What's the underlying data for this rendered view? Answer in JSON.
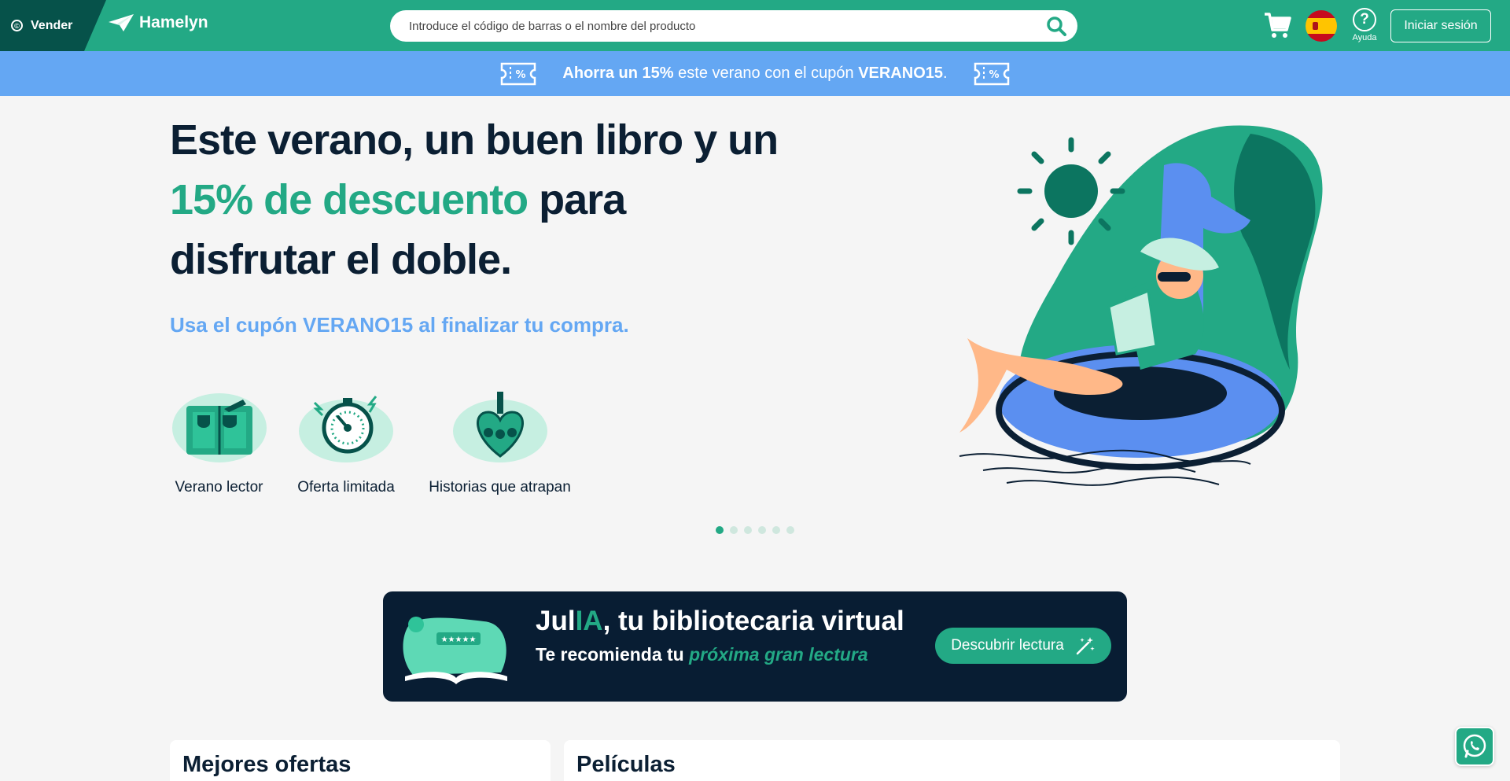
{
  "header": {
    "sell_label": "Vender",
    "logo_text": "Hamelyn",
    "search_placeholder": "Introduce el código de barras o el nombre del producto",
    "help_label": "Ayuda",
    "login_label": "Iniciar sesión",
    "language": "es"
  },
  "promo": {
    "bold_start": "Ahorra un 15%",
    "middle": " este verano con el cupón ",
    "code": "VERANO15",
    "end": "."
  },
  "hero": {
    "title_part1": "Este verano, un buen libro y un ",
    "title_highlight": "15% de descuento",
    "title_part2": " para disfrutar el doble.",
    "subtitle": "Usa el cupón VERANO15 al finalizar tu compra.",
    "features": [
      {
        "label": "Verano lector",
        "icon": "reading-book-icon"
      },
      {
        "label": "Oferta limitada",
        "icon": "stopwatch-icon"
      },
      {
        "label": "Historias que atrapan",
        "icon": "heart-icon"
      }
    ],
    "carousel_slides": 6,
    "carousel_active": 1
  },
  "julia": {
    "title_prefix": "Jul",
    "title_ia": "IA",
    "title_suffix": ", tu bibliotecaria virtual",
    "subtitle_prefix": "Te recomienda tu ",
    "subtitle_highlight": "próxima gran lectura",
    "cta_label": "Descubrir lectura"
  },
  "sections": [
    {
      "title": "Mejores ofertas"
    },
    {
      "title": "Películas"
    }
  ],
  "colors": {
    "brand_green": "#23a985",
    "dark_green": "#06524a",
    "promo_blue": "#64a7f3",
    "navy": "#0b1f33"
  }
}
